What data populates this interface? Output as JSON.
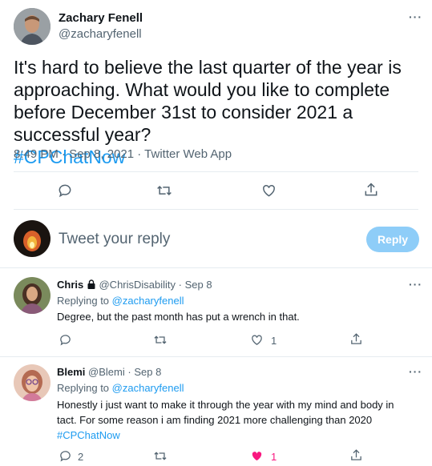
{
  "main_tweet": {
    "author_name": "Zachary Fenell",
    "author_handle": "@zacharyfenell",
    "text": "It's hard to believe the last quarter of the year is approaching. What would you like to complete before December 31st to consider 2021 a successful year?",
    "hashtag": "#CPChatNow",
    "meta": "8:49 PM · Sep 8, 2021 · Twitter Web App"
  },
  "compose": {
    "placeholder": "Tweet your reply",
    "reply_button": "Reply"
  },
  "replies": [
    {
      "author_name": "Chris",
      "author_handle": "@ChrisDisability",
      "separator": "·",
      "date": "Sep 8",
      "replying_to_label": "Replying to",
      "replying_to_handle": "@zacharyfenell",
      "text": "Degree, but the past month has put a wrench in that.",
      "like_count": "1"
    },
    {
      "author_name": "Blemi",
      "author_handle": "@Blemi",
      "separator": "·",
      "date": "Sep 8",
      "replying_to_label": "Replying to",
      "replying_to_handle": "@zacharyfenell",
      "text_line1": "Honestly i just want to make it through the year with my mind and body in",
      "text_line2": "tact. For some reason i am finding 2021 more challenging than 2020",
      "hashtag": "#CPChatNow",
      "reply_count": "2",
      "like_count": "1"
    }
  ],
  "colors": {
    "accent": "#1d9bf0",
    "like_active": "#f91880",
    "muted": "#536471",
    "reply_button_bg": "#8ecdf8"
  },
  "icons": [
    "more-icon",
    "reply-icon",
    "retweet-icon",
    "like-icon",
    "share-icon",
    "lock-icon"
  ]
}
